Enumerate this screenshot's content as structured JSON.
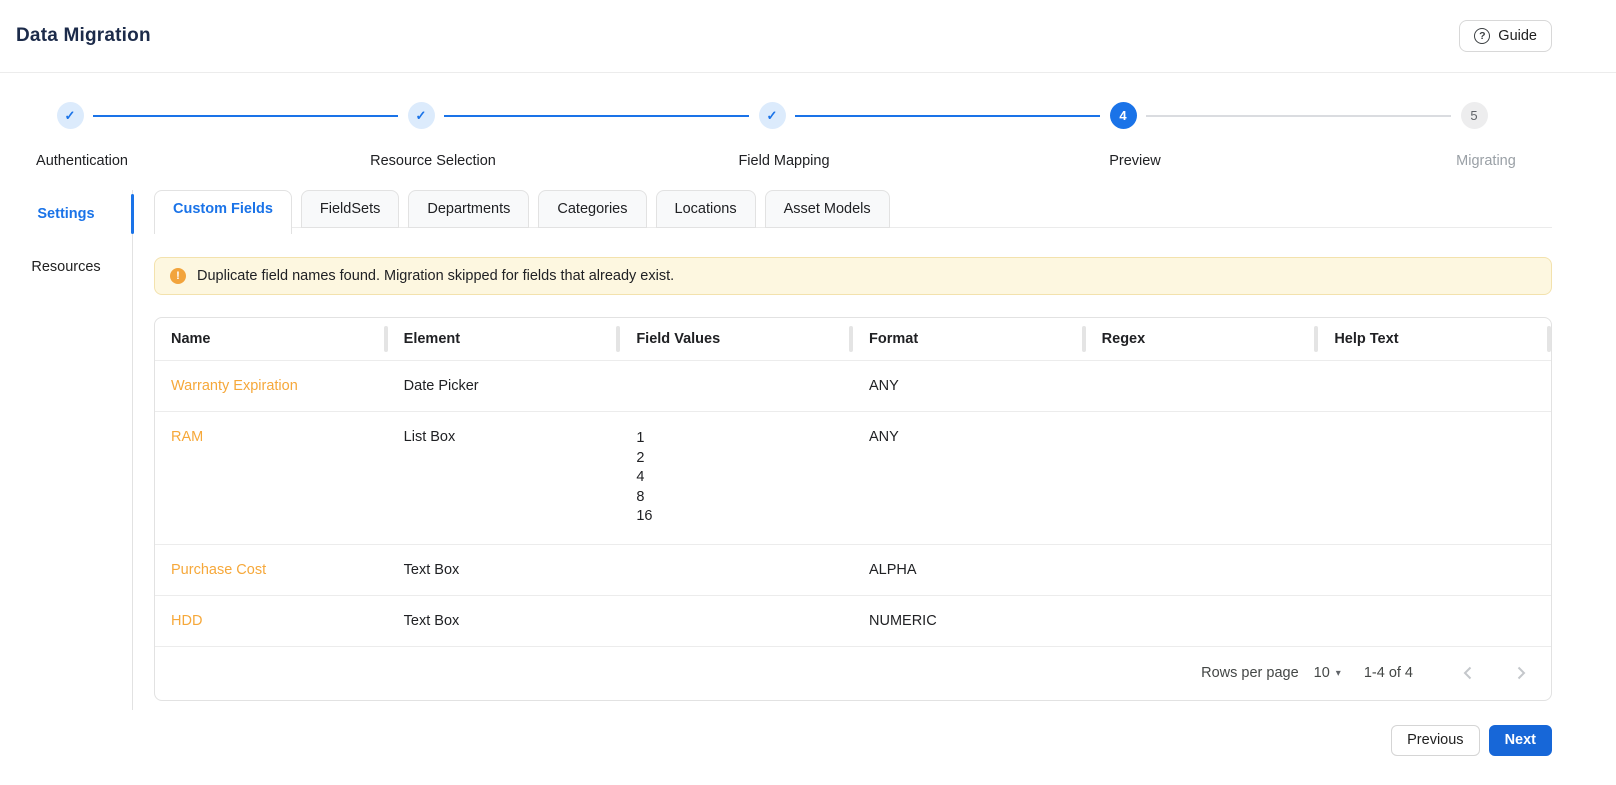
{
  "header": {
    "title": "Data Migration",
    "guide_button": "Guide"
  },
  "icons": {
    "help": "?",
    "warning": "!",
    "check": "✓",
    "dropdown": "▾"
  },
  "stepper": {
    "steps": [
      {
        "label": "Authentication",
        "state": "complete"
      },
      {
        "label": "Resource Selection",
        "state": "complete"
      },
      {
        "label": "Field Mapping",
        "state": "complete"
      },
      {
        "label": "Preview",
        "state": "current",
        "number": "4"
      },
      {
        "label": "Migrating",
        "state": "upcoming",
        "number": "5"
      }
    ]
  },
  "sidebar": {
    "items": [
      {
        "label": "Settings",
        "active": true
      },
      {
        "label": "Resources",
        "active": false
      }
    ]
  },
  "tabs": [
    {
      "label": "Custom Fields",
      "active": true
    },
    {
      "label": "FieldSets",
      "active": false
    },
    {
      "label": "Departments",
      "active": false
    },
    {
      "label": "Categories",
      "active": false
    },
    {
      "label": "Locations",
      "active": false
    },
    {
      "label": "Asset Models",
      "active": false
    }
  ],
  "banner": {
    "message": "Duplicate field names found. Migration skipped for fields that already exist."
  },
  "table": {
    "columns": [
      "Name",
      "Element",
      "Field Values",
      "Format",
      "Regex",
      "Help Text"
    ],
    "rows": [
      {
        "name": "Warranty Expiration",
        "element": "Date Picker",
        "field_values": [],
        "format": "ANY",
        "regex": "",
        "help_text": ""
      },
      {
        "name": "RAM",
        "element": "List Box",
        "field_values": [
          "1",
          "2",
          "4",
          "8",
          "16"
        ],
        "format": "ANY",
        "regex": "",
        "help_text": ""
      },
      {
        "name": "Purchase Cost",
        "element": "Text Box",
        "field_values": [],
        "format": "ALPHA",
        "regex": "",
        "help_text": ""
      },
      {
        "name": "HDD",
        "element": "Text Box",
        "field_values": [],
        "format": "NUMERIC",
        "regex": "",
        "help_text": ""
      }
    ],
    "pagination": {
      "rows_per_page_label": "Rows per page",
      "rows_per_page_value": "10",
      "range": "1-4 of 4"
    }
  },
  "footer": {
    "previous": "Previous",
    "next": "Next"
  },
  "colors": {
    "accent_blue": "#1a73e8",
    "title_navy": "#1c2b4a",
    "link_orange": "#f6a83a",
    "banner_bg": "#fdf7e0",
    "banner_border": "#f3e2ad",
    "warning_orange": "#f2a43c",
    "next_button_bg": "#1767d8",
    "muted_gray": "#9aa0a6"
  }
}
